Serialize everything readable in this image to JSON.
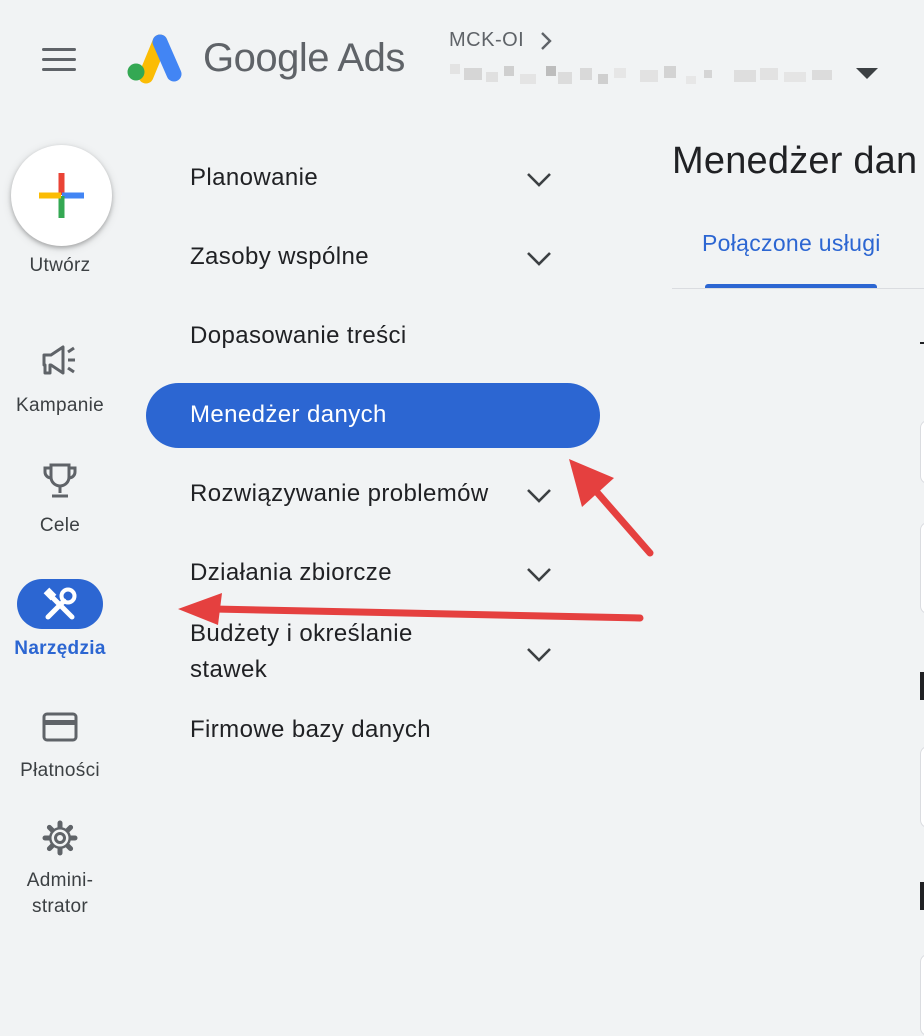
{
  "header": {
    "brand": "Google Ads",
    "account_code": "MCK-OI"
  },
  "nav_rail": {
    "create_label": "Utwórz",
    "items": [
      {
        "label": "Kampanie",
        "icon": "megaphone-icon"
      },
      {
        "label": "Cele",
        "icon": "trophy-icon"
      },
      {
        "label": "Narzędzia",
        "icon": "tools-icon",
        "active": true
      },
      {
        "label": "Płatności",
        "icon": "credit-card-icon"
      },
      {
        "label": "Admini-",
        "label2": "strator",
        "icon": "gear-icon"
      }
    ]
  },
  "submenu": {
    "items": [
      {
        "label": "Planowanie",
        "expandable": true
      },
      {
        "label": "Zasoby wspólne",
        "expandable": true
      },
      {
        "label": "Dopasowanie treści",
        "expandable": false
      },
      {
        "label": "Menedżer danych",
        "expandable": false,
        "active": true
      },
      {
        "label": "Rozwiązywanie problemów",
        "expandable": true
      },
      {
        "label": "Działania zbiorcze",
        "expandable": true
      },
      {
        "label": "Budżety i określanie",
        "label2": "stawek",
        "expandable": true
      },
      {
        "label": "Firmowe bazy danych",
        "expandable": false
      }
    ]
  },
  "content": {
    "page_title": "Menedżer dan",
    "active_tab": "Połączone usługi"
  },
  "colors": {
    "accent": "#2c66d2",
    "background": "#f1f3f4",
    "annotation_arrow": "#e5403f"
  }
}
